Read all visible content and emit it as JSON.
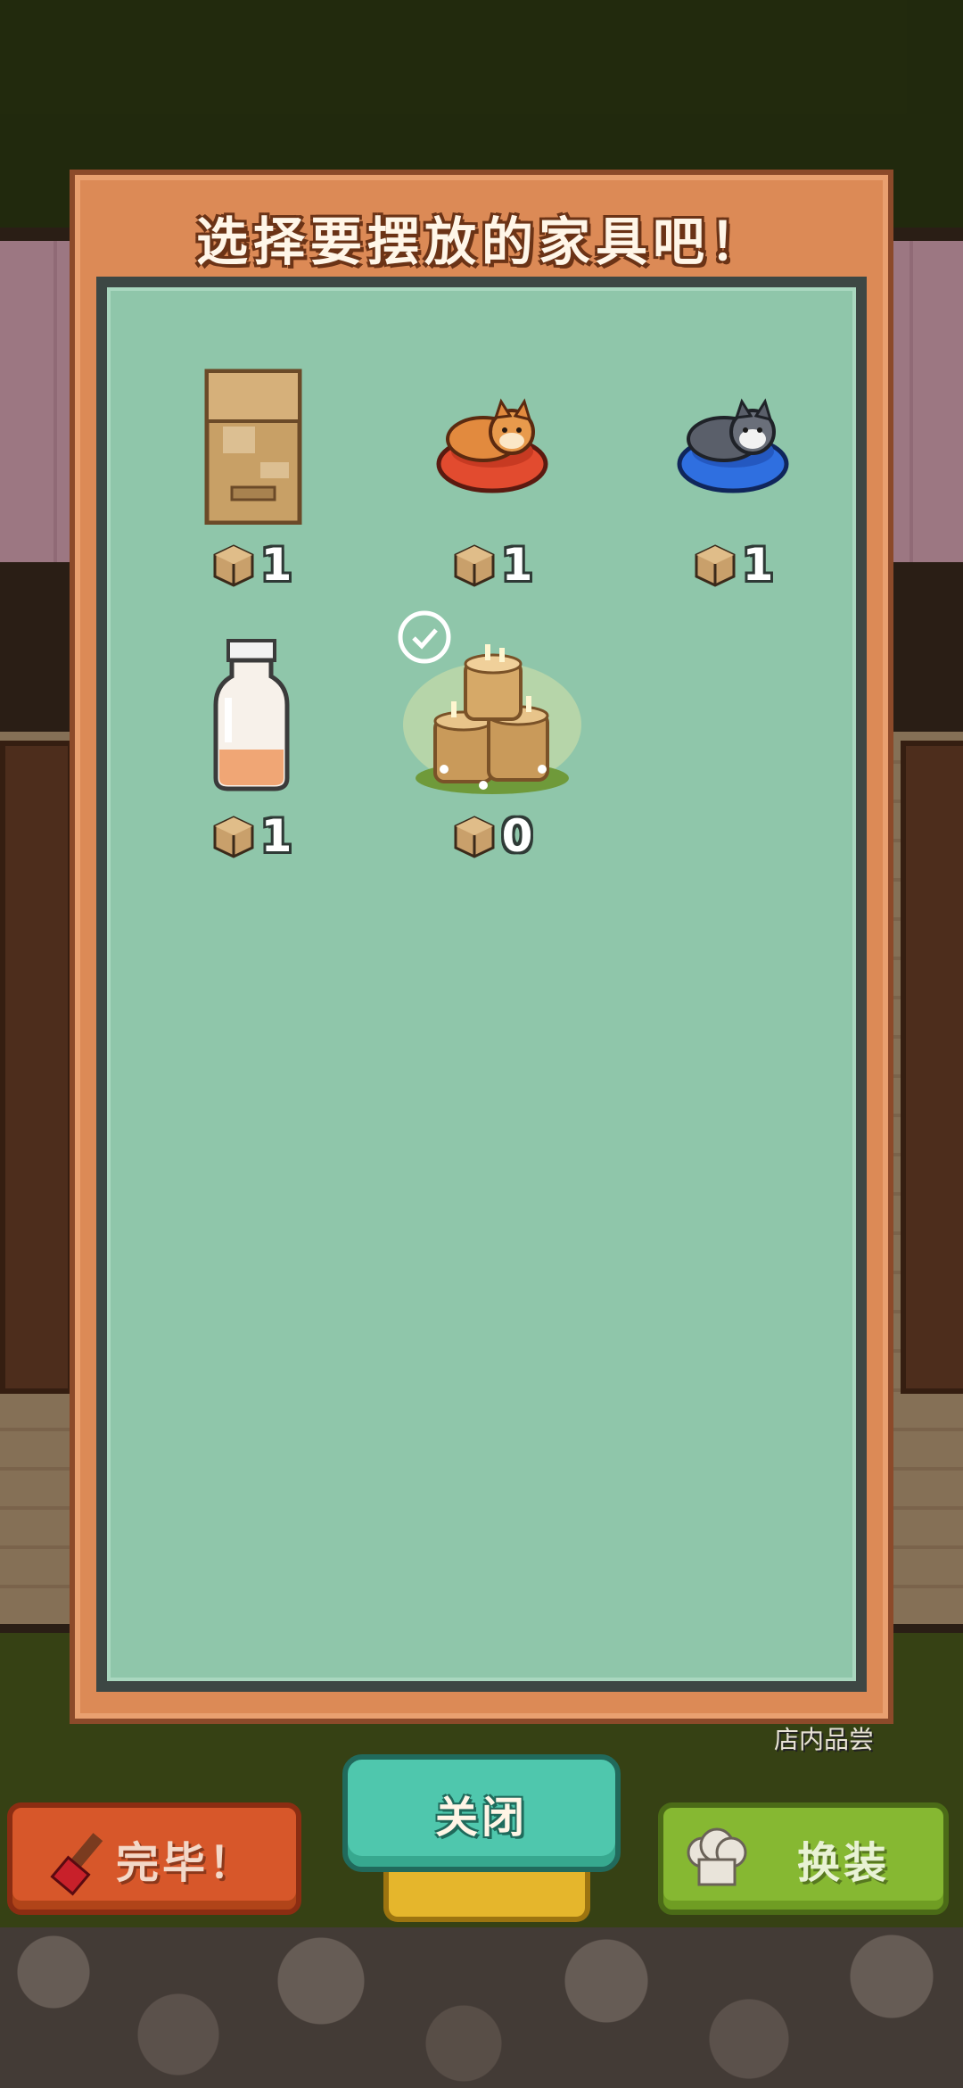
{
  "panel": {
    "title": "选择要摆放的家具吧！"
  },
  "items": [
    {
      "name": "cardboard-box",
      "count": "1"
    },
    {
      "name": "shiba-cat-bed-red",
      "count": "1"
    },
    {
      "name": "husky-cat-bed-blue",
      "count": "1"
    },
    {
      "name": "milk-bottle",
      "count": "1"
    },
    {
      "name": "candle-stumps",
      "count": "0",
      "selected": true
    }
  ],
  "buttons": {
    "done_label": "完毕！",
    "close_label": "关闭",
    "change_label": "换装"
  },
  "background": {
    "shop_label": "店内品尝"
  },
  "colors": {
    "panel_frame": "#dc8a56",
    "panel_inner": "#8fc6aa",
    "close_button": "#4fc7ad",
    "done_button": "#d7572a",
    "change_button": "#86b832"
  }
}
